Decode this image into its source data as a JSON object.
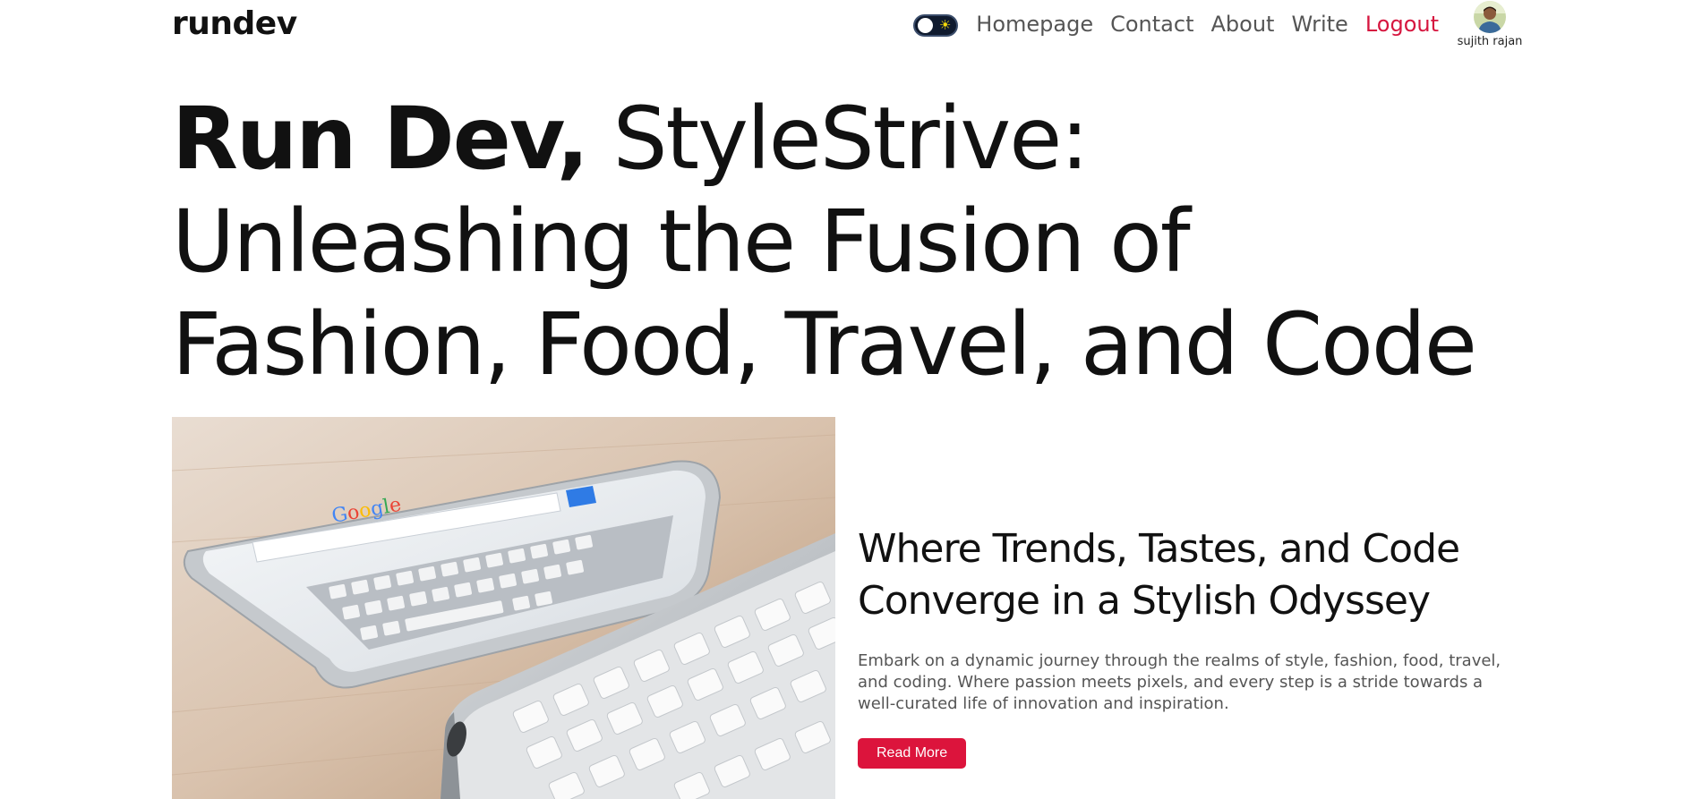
{
  "navbar": {
    "logo": "rundev",
    "theme_toggle_icon": "sun-icon",
    "links": {
      "homepage": "Homepage",
      "contact": "Contact",
      "about": "About",
      "write": "Write",
      "logout": "Logout"
    },
    "user": {
      "name": "sujith rajan"
    }
  },
  "hero": {
    "brand": "Run Dev,",
    "title": "StyleStrive: Unleashing the Fusion of Fashion, Food, Travel, and Code"
  },
  "featured": {
    "image_alt": "tablet and keyboard on a wooden desk",
    "title": "Where Trends, Tastes, and Code Converge in a Stylish Odyssey",
    "description": "Embark on a dynamic journey through the realms of style, fashion, food, travel, and coding. Where passion meets pixels, and every step is a stride towards a well-curated life of innovation and inspiration.",
    "button_label": "Read More"
  },
  "colors": {
    "accent": "#dc143c",
    "nav_text": "#555555",
    "toggle_bg": "#0f1a2e"
  }
}
